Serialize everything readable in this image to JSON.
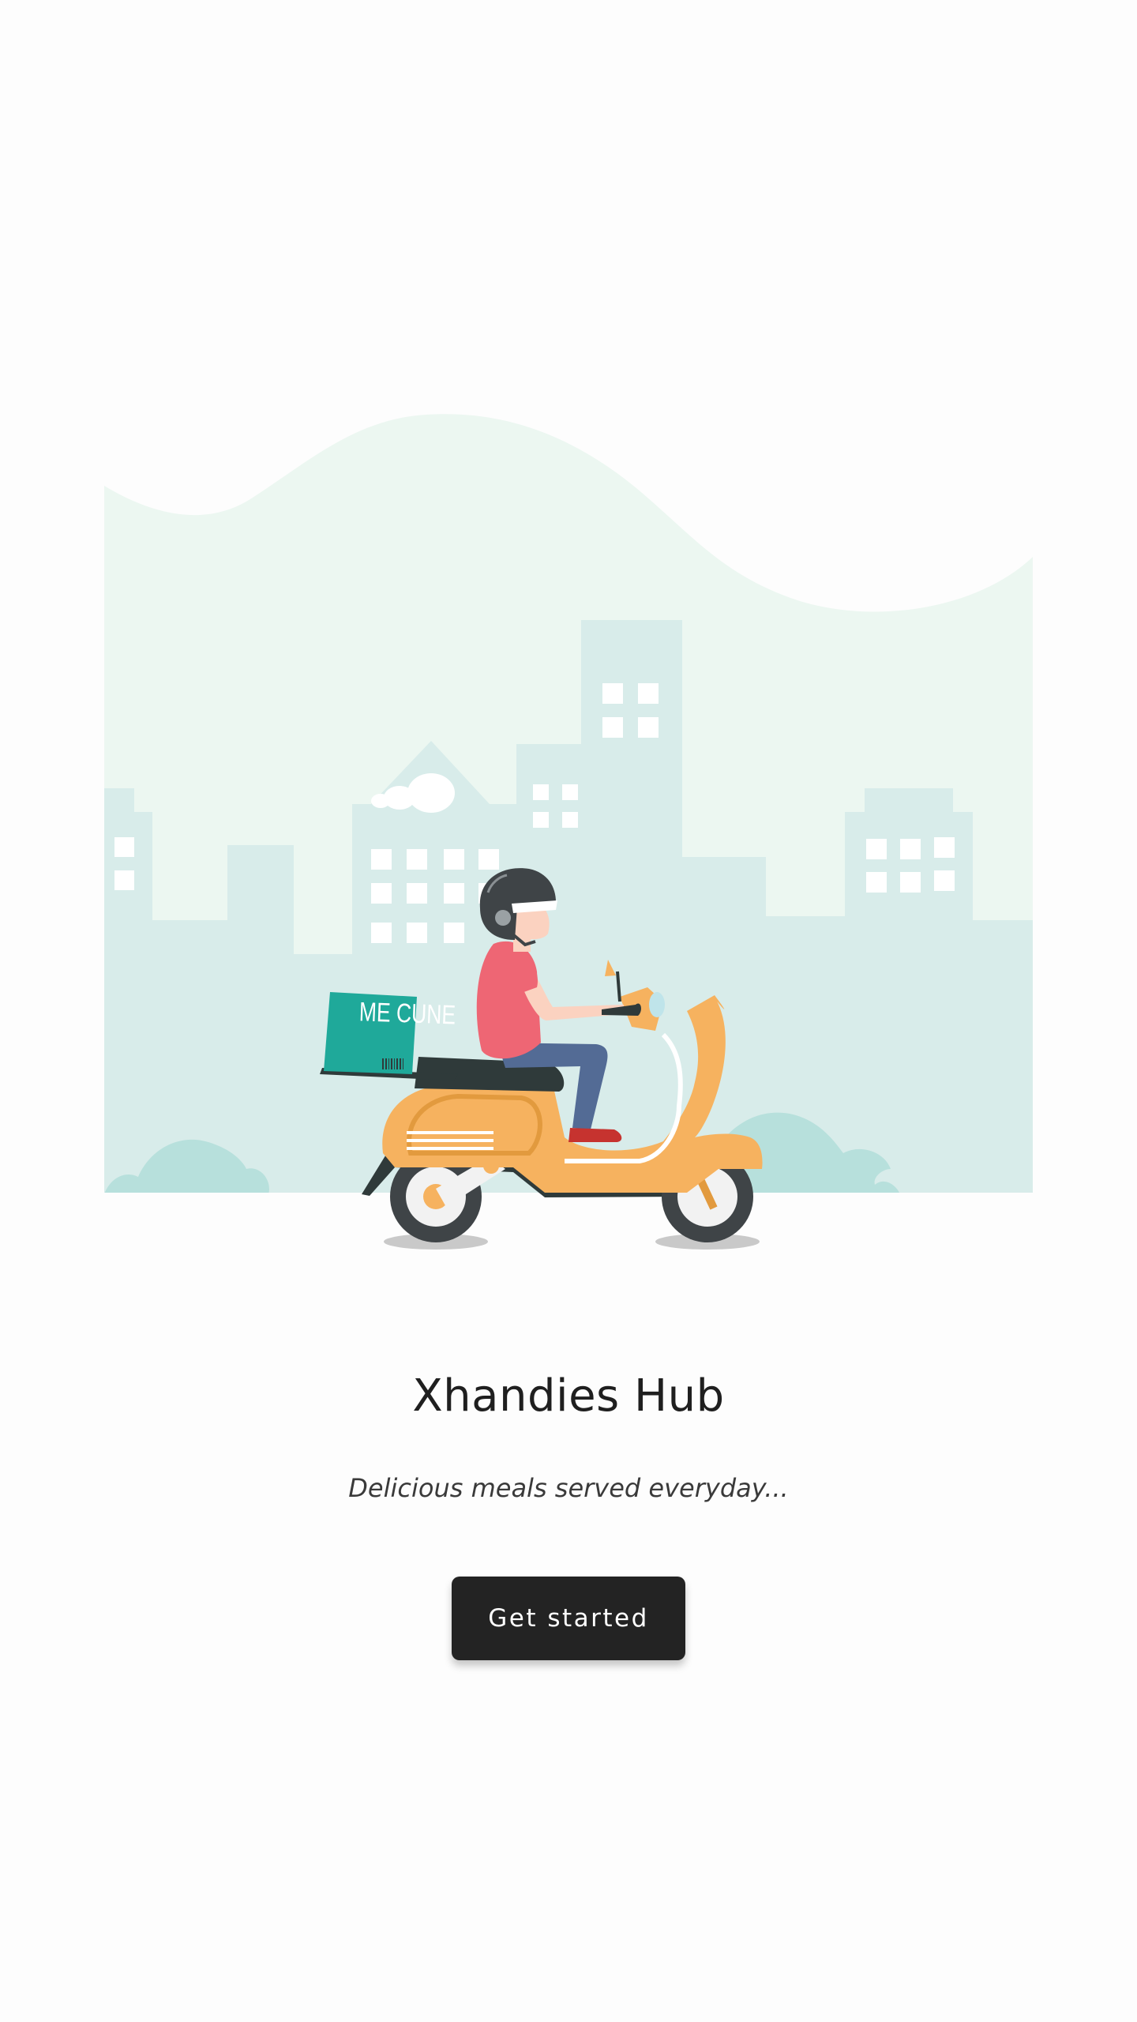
{
  "app": {
    "title": "Xhandies Hub",
    "tagline": "Delicious meals served everyday..."
  },
  "hero": {
    "box_label": "ME CUNE",
    "colors": {
      "sky": "#ecf7f1",
      "buildings": "#d8ecea",
      "bushes": "#b7e0dc",
      "scooter": "#f6b25f",
      "scooter_dark": "#2f3a3a",
      "delivery_box": "#1fa99a",
      "shirt": "#ee6674",
      "helmet": "#3f4447"
    }
  },
  "cta": {
    "label": "Get started"
  },
  "colors": {
    "background": "#fdfdfd",
    "title": "#1f1f1f",
    "tagline": "#3a3a3a",
    "button_bg": "#232323",
    "button_text": "#ffffff"
  }
}
